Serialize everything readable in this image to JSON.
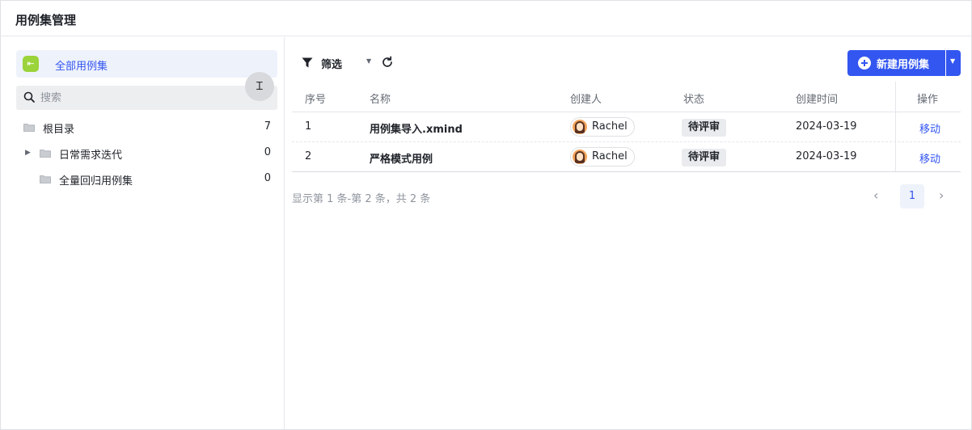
{
  "header": {
    "title": "用例集管理"
  },
  "sidebar": {
    "all_cases_label": "全部用例集",
    "search_placeholder": "搜索",
    "tree": [
      {
        "name": "根目录",
        "count": "7",
        "expandable": false
      },
      {
        "name": "日常需求迭代",
        "count": "0",
        "expandable": true
      },
      {
        "name": "全量回归用例集",
        "count": "0",
        "expandable": false
      }
    ]
  },
  "toolbar": {
    "filter_label": "筛选",
    "new_button_label": "新建用例集"
  },
  "table": {
    "columns": [
      "序号",
      "名称",
      "创建人",
      "状态",
      "创建时间",
      "操作"
    ],
    "rows": [
      {
        "index": "1",
        "name": "用例集导入.xmind",
        "creator": "Rachel",
        "status": "待评审",
        "created": "2024-03-19",
        "action": "移动"
      },
      {
        "index": "2",
        "name": "严格模式用例",
        "creator": "Rachel",
        "status": "待评审",
        "created": "2024-03-19",
        "action": "移动"
      }
    ]
  },
  "pagination": {
    "summary": "显示第 1 条-第 2 条，共 2 条",
    "current_page": "1"
  },
  "colors": {
    "accent": "#3356f0",
    "folder_icon_green": "#9bd33a",
    "status_badge_bg": "#e9ebee"
  },
  "icons": {
    "all_cases": "collection-icon",
    "search": "search-icon",
    "folder": "folder-icon",
    "filter": "filter-icon",
    "refresh": "refresh-icon",
    "new": "plus-circle-icon",
    "dropdown": "caret-down-icon",
    "prev": "chevron-left-icon",
    "next": "chevron-right-icon",
    "cursor": "text-cursor-icon"
  }
}
